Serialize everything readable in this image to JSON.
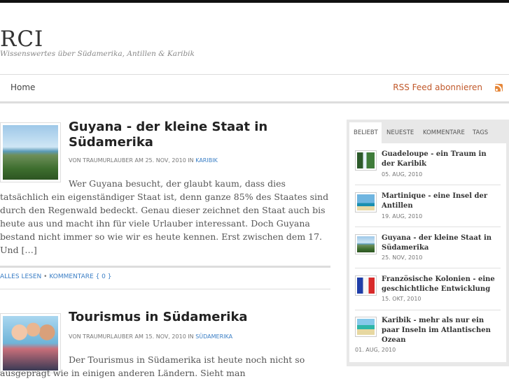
{
  "site": {
    "title": "RCI",
    "description": "Wissenswertes über Südamerika, Antillen & Karibik"
  },
  "nav": {
    "home": "Home",
    "rss": "RSS Feed abonnieren"
  },
  "posts": [
    {
      "title": "Guyana - der kleine Staat in Südamerika",
      "meta_prefix": "von TRAUMURLAUBER am 25. NOV, 2010 in",
      "category": "KARIBIK",
      "excerpt": "Wer Guyana besucht, der glaubt kaum, dass dies tatsächlich ein eigenständiger Staat ist, denn ganze 85% des Staates sind durch den Regenwald bedeckt. Genau dieser zeichnet den Staat auch bis heute aus und macht ihn für viele Urlauber interessant. Doch Guyana bestand nicht immer so wie wir es heute kennen. Erst zwischen dem 17. Und […]",
      "read_more": "ALLES LESEN",
      "separator": "•",
      "comments": "KOMMENTARE { 0 }",
      "thumb_icon": "island-photo"
    },
    {
      "title": "Tourismus in Südamerika",
      "meta_prefix": "von TRAUMURLAUBER am 15. NOV, 2010 in",
      "category": "SÜDAMERIKA",
      "excerpt": "Der Tourismus in Südamerika ist heute noch nicht so ausgeprägt wie in einigen anderen Ländern. Sieht man",
      "thumb_icon": "people-photo"
    }
  ],
  "sidebar": {
    "tabs": [
      "BELIEBT",
      "NEUESTE",
      "KOMMENTARE",
      "TAGS"
    ],
    "active_tab": 0,
    "items": [
      {
        "title": "Guadeloupe - ein Traum in der Karibik",
        "date": "05. AUG, 2010",
        "thumb_icon": "waterfall-photo"
      },
      {
        "title": "Martinique - eine Insel der Antillen",
        "date": "19. AUG, 2010",
        "thumb_icon": "palm-photo"
      },
      {
        "title": "Guyana - der kleine Staat in Südamerika",
        "date": "25. NOV, 2010",
        "thumb_icon": "island-photo"
      },
      {
        "title": "Französische Kolonien - eine geschichtliche Entwicklung",
        "date": "15. OKT, 2010",
        "thumb_icon": "flag-photo"
      },
      {
        "title": "Karibik - mehr als nur ein paar Inseln im Atlantischen Ozean",
        "date": "01. AUG, 2010",
        "thumb_icon": "beach-photo"
      }
    ]
  },
  "colors": {
    "link": "#3a7ec5",
    "rss": "#c1592b",
    "topbar": "#111111"
  }
}
